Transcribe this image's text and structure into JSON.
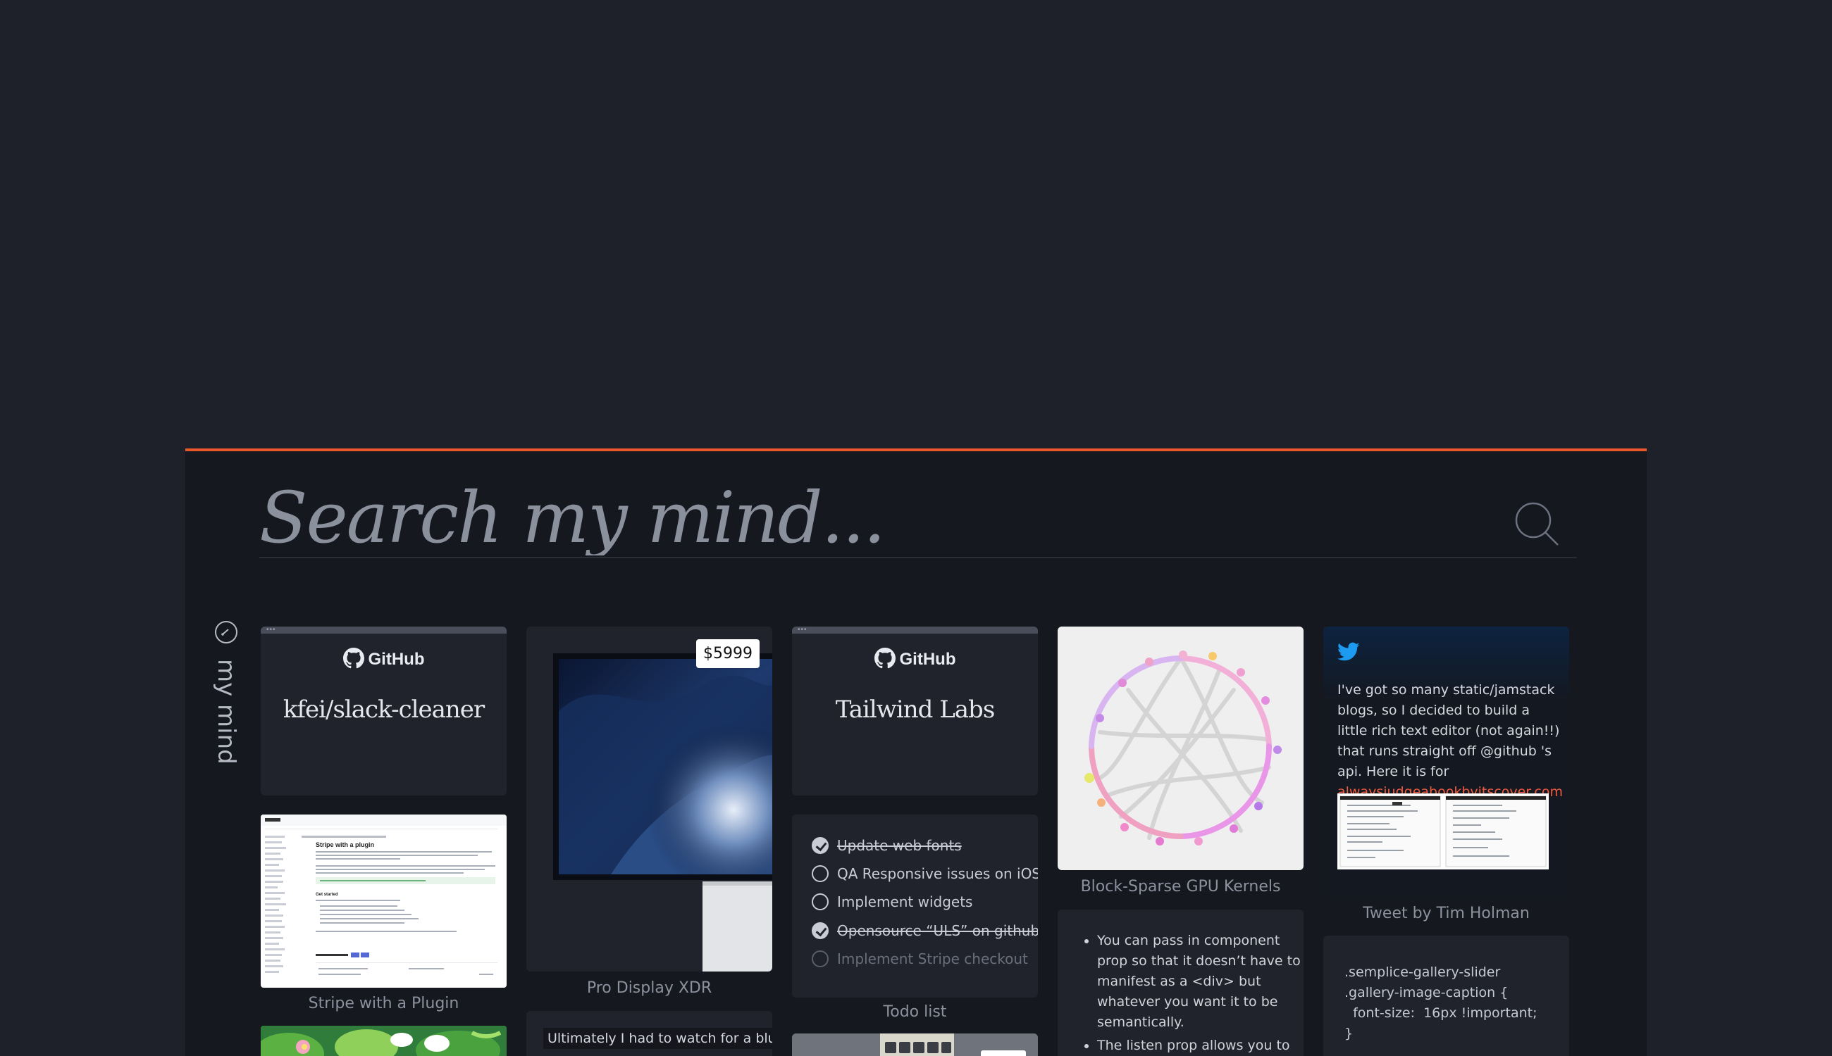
{
  "search": {
    "placeholder": "Search my mind..."
  },
  "brand": {
    "text": "my mind"
  },
  "cards": {
    "github1": {
      "brand": "GitHub",
      "title": "kfei/slack-cleaner"
    },
    "stripe": {
      "caption": "Stripe with a Plugin",
      "doc_title": "Stripe with a plugin",
      "doc_heading": "Get started"
    },
    "xdr": {
      "price": "$5999",
      "caption": "Pro Display XDR"
    },
    "blur_note": {
      "text": "Ultimately I had to watch for a blur"
    },
    "github2": {
      "brand": "GitHub",
      "title": "Tailwind Labs"
    },
    "todo": {
      "caption": "Todo list",
      "items": [
        {
          "label": "Update web fonts"
        },
        {
          "label": "QA Responsive issues on iOS"
        },
        {
          "label": "Implement widgets"
        },
        {
          "label": "Opensource “ULS” on github"
        },
        {
          "label": "Implement Stripe checkout"
        }
      ]
    },
    "gpu": {
      "caption": "Block-Sparse GPU Kernels"
    },
    "notes": {
      "bullets": [
        "You can pass in component prop so that it doesn’t have to manifest as a <div> but whatever you want it to be semantically.",
        "The listen prop allows you to"
      ]
    },
    "tweet": {
      "text": "I've got so many static/jamstack blogs, so I decided to build a little rich text editor (not again!!) that runs straight off @github 's api. Here it is for ",
      "link": "alwaysjudgeabookbyitscover.com",
      "caption": "Tweet by Tim Holman"
    },
    "code": {
      "text": ".semplice-gallery-slider .gallery-image-caption {\n  font-size:  16px !important;\n}"
    }
  },
  "colors": {
    "accent": "#e8582a",
    "link": "#f05a3d",
    "twitter": "#1d9bf0",
    "background": "#1f212a",
    "panel": "#16181f"
  },
  "icons": [
    "search-icon",
    "brand-icon",
    "github-icon",
    "twitter-icon",
    "check-icon"
  ]
}
